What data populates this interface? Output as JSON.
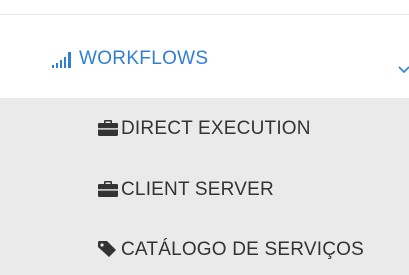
{
  "colors": {
    "accent": "#2f7fd6",
    "submenu_background": "#eaeaea",
    "submenu_text": "#333333"
  },
  "nav": {
    "header": {
      "icon": "signal-bars-icon",
      "label": "WORKFLOWS",
      "toggle_icon": "chevron-down-icon"
    },
    "items": [
      {
        "icon": "briefcase-icon",
        "label": "DIRECT EXECUTION"
      },
      {
        "icon": "briefcase-icon",
        "label": "CLIENT SERVER"
      },
      {
        "icon": "tag-icon",
        "label": "CATÁLOGO DE SERVIÇOS"
      }
    ]
  }
}
